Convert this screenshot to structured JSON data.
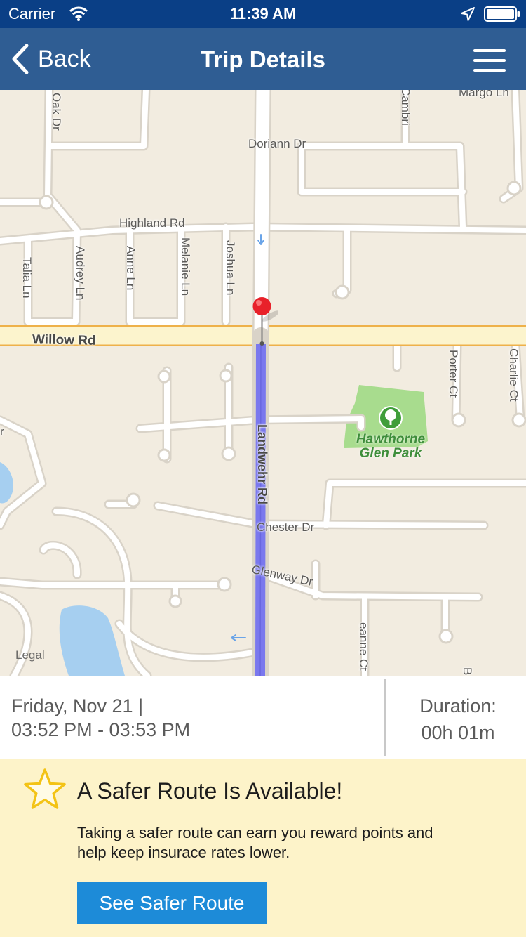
{
  "status_bar": {
    "carrier": "Carrier",
    "time": "11:39 AM"
  },
  "nav": {
    "back_label": "Back",
    "title": "Trip Details"
  },
  "map": {
    "roads": {
      "willow": "Willow Rd",
      "highland": "Highland Rd",
      "doriann": "Doriann Dr",
      "margo": "Margo Ln",
      "cambridge": "Cambri",
      "oak": "Oak Dr",
      "talia": "Talia Ln",
      "audrey": "Audrey Ln",
      "anne": "Anne Ln",
      "melanie": "Melanie Ln",
      "joshua": "Joshua Ln",
      "landwehr": "Landwehr Rd",
      "chester": "Chester Dr",
      "glenway": "Glenway Dr",
      "porter": "Porter Ct",
      "charlie": "Charlie Ct",
      "jeanne": "eanne Ct",
      "edge_b": "B",
      "edge_r": "r"
    },
    "park_name": "Hawthorne Glen Park",
    "legal": "Legal"
  },
  "trip": {
    "date_line": "Friday, Nov 21 |",
    "time_range": "03:52 PM - 03:53 PM",
    "duration_label": "Duration:",
    "duration_value": "00h 01m"
  },
  "safer_route": {
    "title": "A Safer Route Is Available!",
    "body": "Taking a safer route can earn you reward points and help keep insurace rates lower.",
    "button_label": "See Safer Route"
  },
  "colors": {
    "status_bar": "#0a3f86",
    "nav_bar": "#2f5d93",
    "route": "#7a78ee",
    "pin": "#e8212a",
    "button": "#1d8bd8",
    "banner": "#fdf3c9"
  },
  "icons": [
    "wifi-icon",
    "location-arrow-icon",
    "battery-icon",
    "back-chevron-icon",
    "hamburger-menu-icon",
    "tree-icon",
    "map-pin-icon",
    "star-icon"
  ]
}
